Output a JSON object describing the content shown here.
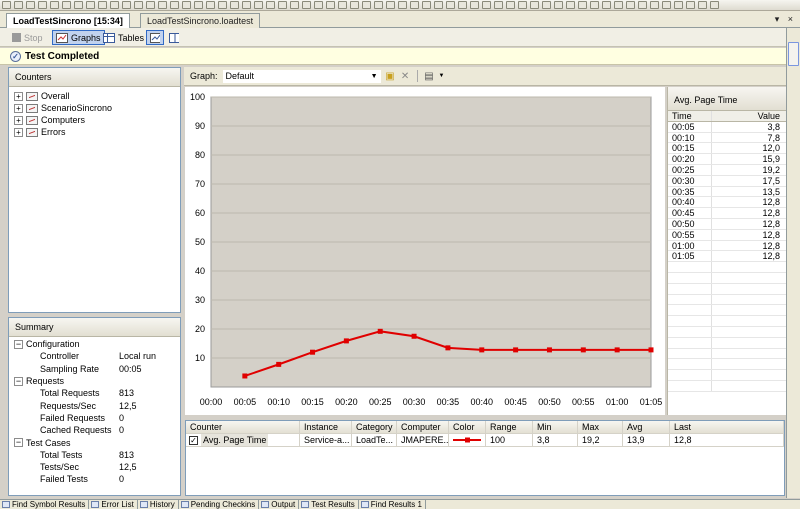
{
  "doc_tabs": [
    {
      "label": "LoadTestSincrono [15:34]",
      "active": true
    },
    {
      "label": "LoadTestSincrono.loadtest",
      "active": false
    }
  ],
  "window_controls": "▾ ×",
  "view_toolbar": {
    "stop_label": "Stop",
    "graphs_label": "Graphs",
    "tables_label": "Tables"
  },
  "status": {
    "text": "Test Completed"
  },
  "counters_panel": {
    "title": "Counters",
    "items": [
      {
        "label": "Overall"
      },
      {
        "label": "ScenarioSincrono"
      },
      {
        "label": "Computers"
      },
      {
        "label": "Errors"
      }
    ]
  },
  "summary_panel": {
    "title": "Summary",
    "sections": [
      {
        "label": "Configuration",
        "rows": [
          {
            "key": "Controller",
            "value": "Local run"
          },
          {
            "key": "Sampling Rate",
            "value": "00:05"
          }
        ]
      },
      {
        "label": "Requests",
        "rows": [
          {
            "key": "Total Requests",
            "value": "813"
          },
          {
            "key": "Requests/Sec",
            "value": "12,5"
          },
          {
            "key": "Failed Requests",
            "value": "0"
          },
          {
            "key": "Cached Requests",
            "value": "0"
          }
        ]
      },
      {
        "label": "Test Cases",
        "rows": [
          {
            "key": "Total Tests",
            "value": "813"
          },
          {
            "key": "Tests/Sec",
            "value": "12,5"
          },
          {
            "key": "Failed Tests",
            "value": "0"
          }
        ]
      }
    ]
  },
  "graph_toolbar": {
    "label": "Graph:",
    "selected": "Default"
  },
  "chart_data": {
    "type": "line",
    "x": [
      "00:00",
      "00:05",
      "00:10",
      "00:15",
      "00:20",
      "00:25",
      "00:30",
      "00:35",
      "00:40",
      "00:45",
      "00:50",
      "00:55",
      "01:00",
      "01:05"
    ],
    "y_ticks": [
      "100",
      "90",
      "80",
      "70",
      "60",
      "50",
      "40",
      "30",
      "20",
      "10"
    ],
    "ylim": [
      0,
      100
    ],
    "series": [
      {
        "color": "#e00000",
        "x": [
          "00:05",
          "00:10",
          "00:15",
          "00:20",
          "00:25",
          "00:30",
          "00:35",
          "00:40",
          "00:45",
          "00:50",
          "00:55",
          "01:00",
          "01:05"
        ],
        "values": [
          3.8,
          7.8,
          12.0,
          15.9,
          19.2,
          17.5,
          13.5,
          12.8,
          12.8,
          12.8,
          12.8,
          12.8,
          12.8
        ]
      }
    ],
    "background": "#d4d0c8",
    "grid": true
  },
  "value_panel": {
    "title": "Avg. Page Time",
    "headers": [
      "Time",
      "Value"
    ],
    "rows": [
      [
        "00:05",
        "3,8"
      ],
      [
        "00:10",
        "7,8"
      ],
      [
        "00:15",
        "12,0"
      ],
      [
        "00:20",
        "15,9"
      ],
      [
        "00:25",
        "19,2"
      ],
      [
        "00:30",
        "17,5"
      ],
      [
        "00:35",
        "13,5"
      ],
      [
        "00:40",
        "12,8"
      ],
      [
        "00:45",
        "12,8"
      ],
      [
        "00:50",
        "12,8"
      ],
      [
        "00:55",
        "12,8"
      ],
      [
        "01:00",
        "12,8"
      ],
      [
        "01:05",
        "12,8"
      ]
    ]
  },
  "legend_table": {
    "headers": [
      "Counter",
      "Instance",
      "Category",
      "Computer",
      "Color",
      "Range",
      "Min",
      "Max",
      "Avg",
      "Last"
    ],
    "rows": [
      {
        "checked": true,
        "counter": "Avg. Page Time",
        "instance": "Service-a...",
        "category": "LoadTe...",
        "computer": "JMAPERE...",
        "color": "#e00000",
        "range": "100",
        "min": "3,8",
        "max": "19,2",
        "avg": "13,9",
        "last": "12,8"
      }
    ]
  },
  "bottom_tabs": [
    "Find Symbol Results",
    "Error List",
    "History",
    "Pending Checkins",
    "Output",
    "Test Results",
    "Find Results 1"
  ]
}
